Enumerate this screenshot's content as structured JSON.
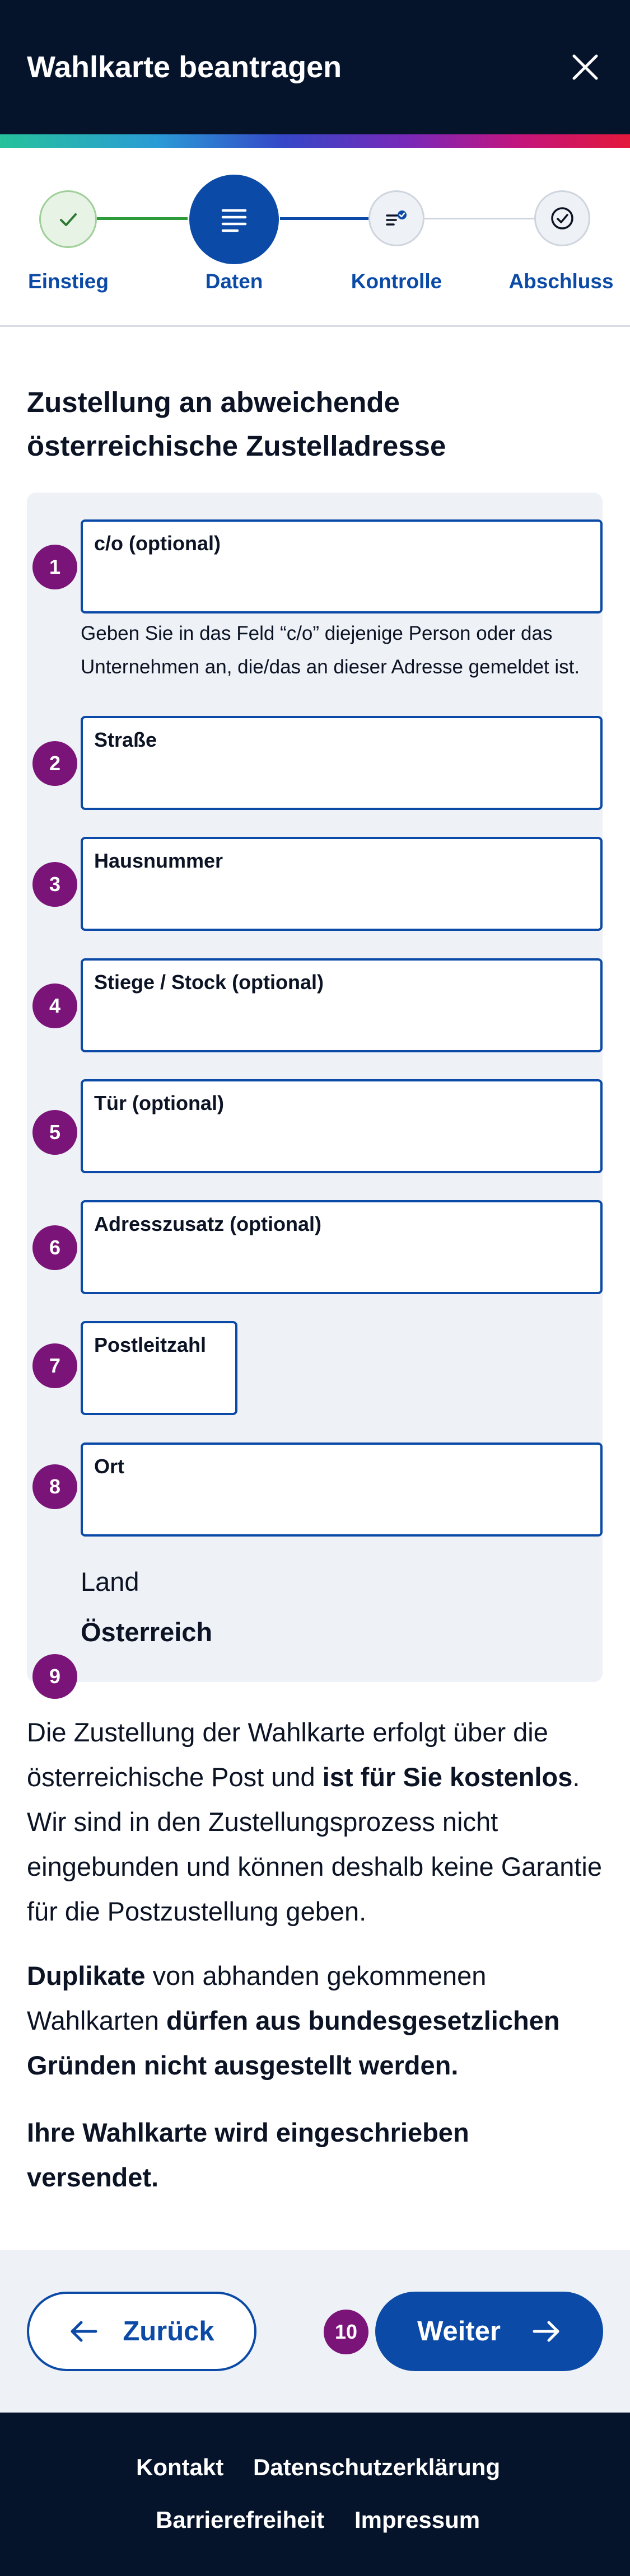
{
  "header": {
    "title": "Wahlkarte beantragen",
    "close_icon": "close-icon"
  },
  "stepper": {
    "steps": [
      {
        "label": "Einstieg",
        "state": "done",
        "icon": "check-icon"
      },
      {
        "label": "Daten",
        "state": "active",
        "icon": "list-icon"
      },
      {
        "label": "Kontrolle",
        "state": "upcoming",
        "icon": "checklist-icon"
      },
      {
        "label": "Abschluss",
        "state": "upcoming",
        "icon": "check-circle-icon"
      }
    ]
  },
  "main": {
    "heading": "Zustellung an abweichende österreichische Zustelladresse",
    "fields": [
      {
        "badge": "1",
        "label": "c/o (optional)",
        "value": ""
      },
      {
        "badge": "2",
        "label": "Straße",
        "value": ""
      },
      {
        "badge": "3",
        "label": "Hausnummer",
        "value": ""
      },
      {
        "badge": "4",
        "label": "Stiege / Stock (optional)",
        "value": ""
      },
      {
        "badge": "5",
        "label": "Tür (optional)",
        "value": ""
      },
      {
        "badge": "6",
        "label": "Adresszusatz (optional)",
        "value": ""
      },
      {
        "badge": "7",
        "label": "Postleitzahl",
        "value": ""
      },
      {
        "badge": "8",
        "label": "Ort",
        "value": ""
      }
    ],
    "co_hint": "Geben Sie in das Feld “c/o” diejenige Person oder das Unternehmen an, die/das an dieser Adresse gemeldet ist.",
    "land_label": "Land",
    "land_value": "Österreich",
    "land_badge": "9",
    "info": {
      "p1_part1": "Die Zustellung der Wahlkarte erfolgt über die österreichische Post und ",
      "p1_bold": "ist für Sie kostenlos",
      "p1_part2": ". Wir sind in den Zustellungsprozess nicht eingebunden und können deshalb keine Garantie für die Postzustellung geben.",
      "p2_bold1": "Duplikate",
      "p2_part1": " von abhanden gekommenen Wahlkarten ",
      "p2_bold2": "dürfen aus bundesgesetzlichen Gründen nicht ausgestellt werden.",
      "p3_bold": "Ihre Wahlkarte wird eingeschrieben versendet."
    }
  },
  "actions": {
    "back_label": "Zurück",
    "next_label": "Weiter",
    "next_badge": "10"
  },
  "footer": {
    "links": [
      "Kontakt",
      "Datenschutzerklärung",
      "Barrierefreiheit",
      "Impressum"
    ]
  },
  "colors": {
    "brand_blue": "#0b4aa6",
    "navy": "#06142b",
    "success_green": "#2e9b3a",
    "badge_purple": "#7a1479",
    "panel_bg": "#eef1f5"
  }
}
